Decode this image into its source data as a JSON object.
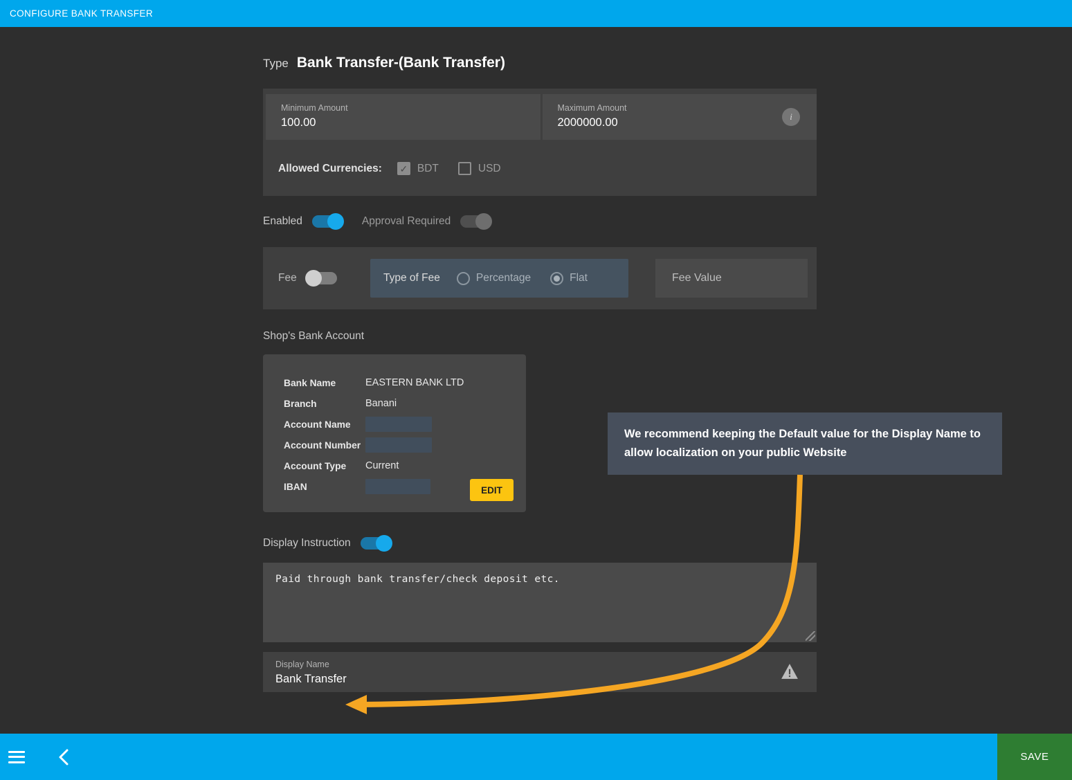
{
  "titlebar": {
    "title": "CONFIGURE BANK TRANSFER"
  },
  "type": {
    "label": "Type",
    "value": "Bank Transfer-(Bank Transfer)"
  },
  "amounts": {
    "minimum": {
      "label": "Minimum Amount",
      "value": "100.00"
    },
    "maximum": {
      "label": "Maximum Amount",
      "value": "2000000.00"
    },
    "info_icon": "i"
  },
  "currencies": {
    "label": "Allowed Currencies:",
    "options": [
      {
        "code": "BDT",
        "checked": true,
        "mark": "✓"
      },
      {
        "code": "USD",
        "checked": false,
        "mark": ""
      }
    ]
  },
  "toggles": {
    "enabled": {
      "label": "Enabled",
      "on": true
    },
    "approval_required": {
      "label": "Approval Required",
      "on": false
    }
  },
  "fee": {
    "label": "Fee",
    "on": false,
    "type_of_fee_label": "Type of Fee",
    "options": [
      {
        "label": "Percentage",
        "selected": false
      },
      {
        "label": "Flat",
        "selected": true
      }
    ],
    "value_placeholder": "Fee Value",
    "value": ""
  },
  "bank_account": {
    "section_label": "Shop's Bank Account",
    "rows": [
      {
        "key": "Bank Name",
        "value": "EASTERN BANK LTD",
        "redacted": false
      },
      {
        "key": "Branch",
        "value": "Banani",
        "redacted": false
      },
      {
        "key": "Account Name",
        "value": "",
        "redacted": true
      },
      {
        "key": "Account Number",
        "value": "",
        "redacted": true
      },
      {
        "key": "Account Type",
        "value": "Current",
        "redacted": false
      },
      {
        "key": "IBAN",
        "value": "",
        "redacted": true
      }
    ],
    "edit_label": "EDIT"
  },
  "display_instruction": {
    "label": "Display Instruction",
    "on": true,
    "text": "Paid through bank transfer/check deposit etc."
  },
  "display_name": {
    "label": "Display Name",
    "value": "Bank Transfer",
    "warning_icon": "warning-triangle"
  },
  "callout": {
    "text": "We recommend keeping the Default value for the Display Name to allow localization on your public Website",
    "arrow_color": "#f5a623"
  },
  "bottombar": {
    "menu_icon": "hamburger-icon",
    "back_icon": "chevron-left-icon",
    "save_label": "SAVE"
  },
  "colors": {
    "accent_blue": "#00a7ec",
    "save_green": "#2e7d32",
    "edit_yellow": "#fcc410",
    "arrow_orange": "#f5a623",
    "panel_bg": "#3f3f3f",
    "page_bg": "#2e2e2e"
  }
}
